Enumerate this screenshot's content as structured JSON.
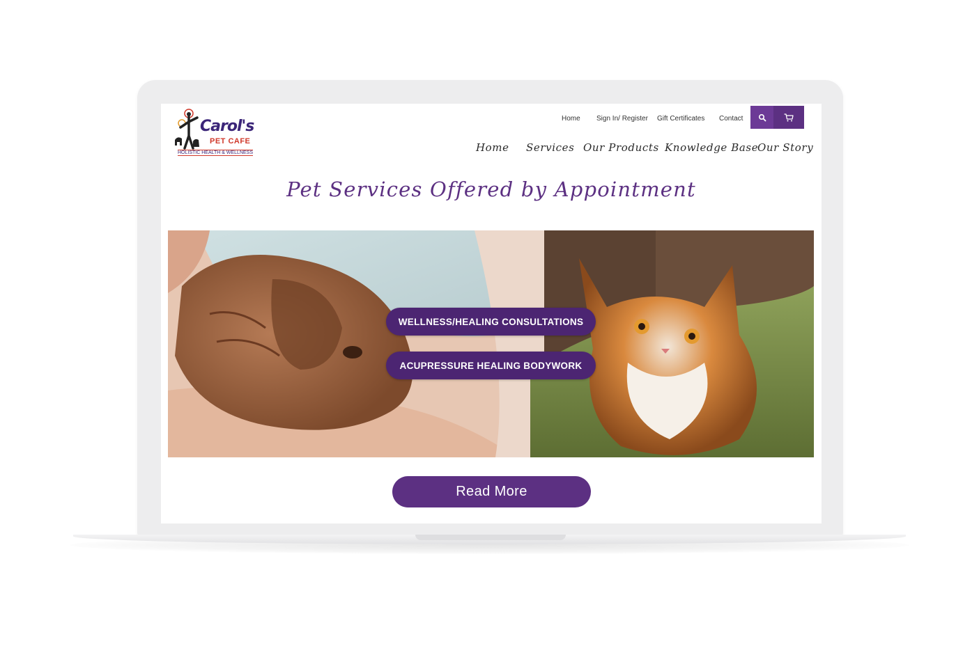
{
  "brand": {
    "logo_name": "Carol's",
    "logo_sub": "PET CAFE",
    "logo_tagline": "HOLISTIC HEALTH & WELLNESS"
  },
  "utility_nav": {
    "home": "Home",
    "sign_in": "Sign In/ Register",
    "gift_certificates": "Gift Certificates",
    "contact": "Contact"
  },
  "icons": {
    "search": "search-icon",
    "cart": "cart-icon"
  },
  "main_nav": {
    "items": [
      "Home",
      "Services",
      "Our Products",
      "Knowledge Base",
      "Our Story"
    ]
  },
  "page": {
    "heading": "Pet Services Offered by Appointment"
  },
  "hero": {
    "button_1": "WELLNESS/HEALING CONSULTATIONS",
    "button_2": "ACUPRESSURE HEALING BODYWORK"
  },
  "cta": {
    "read_more": "Read More"
  },
  "colors": {
    "brand_purple": "#5c3082",
    "pill_purple": "#4c2572",
    "logo_red": "#d0392b"
  }
}
